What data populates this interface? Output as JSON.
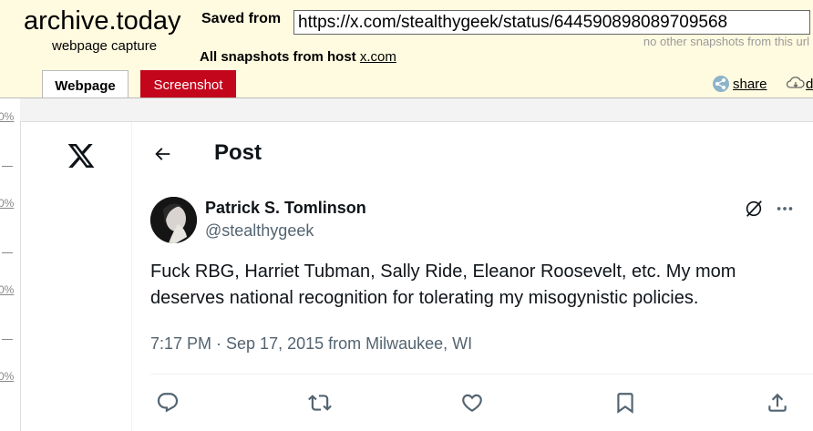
{
  "archive": {
    "logo": "archive.today",
    "subtitle": "webpage capture",
    "saved_from_label": "Saved from",
    "url": "https://x.com/stealthygeek/status/644590898089709568",
    "no_other": "no other snapshots from this url",
    "all_snapshots_label": "All snapshots  from host",
    "host": "x.com",
    "tabs": [
      {
        "label": "Webpage",
        "active": true
      },
      {
        "label": "Screenshot",
        "active": false
      }
    ],
    "share_label": "share",
    "cloud_label": "d"
  },
  "ruler": [
    "0%",
    "0%",
    "0%",
    "0%"
  ],
  "twitter": {
    "logo_icon": "x-logo-icon",
    "header_title": "Post",
    "author": {
      "name": "Patrick S. Tomlinson",
      "handle": "@stealthygeek"
    },
    "text": "Fuck RBG, Harriet Tubman, Sally Ride, Eleanor Roosevelt, etc. My mom deserves national recognition for tolerating my misogynistic policies.",
    "meta": "7:17 PM · Sep 17, 2015 from Milwaukee, WI",
    "actions": [
      "reply-icon",
      "retweet-icon",
      "like-icon",
      "bookmark-icon",
      "share-icon"
    ]
  },
  "colors": {
    "archive_bg": "#fffbe0",
    "screenshot_tab": "#c4061c",
    "text_primary": "#0f1419",
    "text_secondary": "#536471"
  }
}
